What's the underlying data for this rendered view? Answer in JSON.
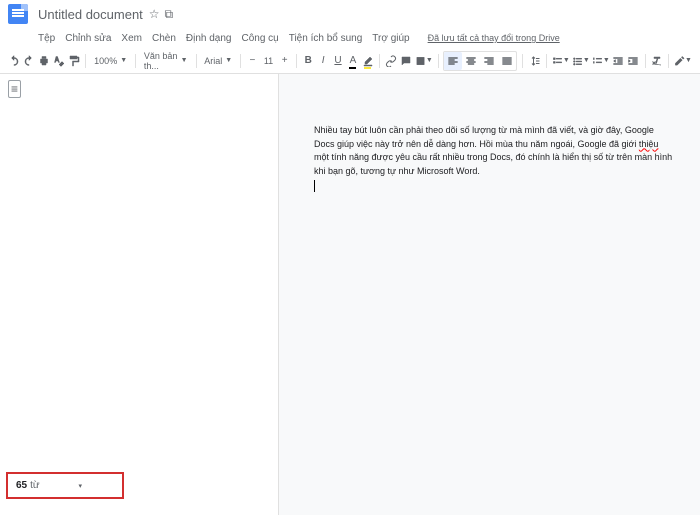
{
  "header": {
    "title": "Untitled document",
    "star": "☆",
    "folder": "⧉"
  },
  "menubar": {
    "items": [
      "Tệp",
      "Chỉnh sửa",
      "Xem",
      "Chèn",
      "Định dạng",
      "Công cụ",
      "Tiện ích bổ sung",
      "Trợ giúp"
    ],
    "drive_status": "Đã lưu tất cả thay đổi trong Drive"
  },
  "toolbar": {
    "zoom": "100%",
    "style": "Văn bản th...",
    "font": "Arial",
    "size": "11"
  },
  "document": {
    "paragraph_before": "Nhiều tay bút luôn cần phải theo dõi số lượng từ mà mình đã viết, và giờ đây, Google Docs giúp việc này trở nên dễ dàng hơn. Hồi mùa thu năm ngoái, Google đã giới ",
    "spell_word": "thiệu",
    "paragraph_after": " một tính năng được yêu cầu rất nhiều trong Docs, đó chính là hiển thị số từ trên màn hình khi bạn gõ, tương tự như Microsoft Word."
  },
  "wordcount": {
    "value": "65",
    "label": "từ"
  }
}
